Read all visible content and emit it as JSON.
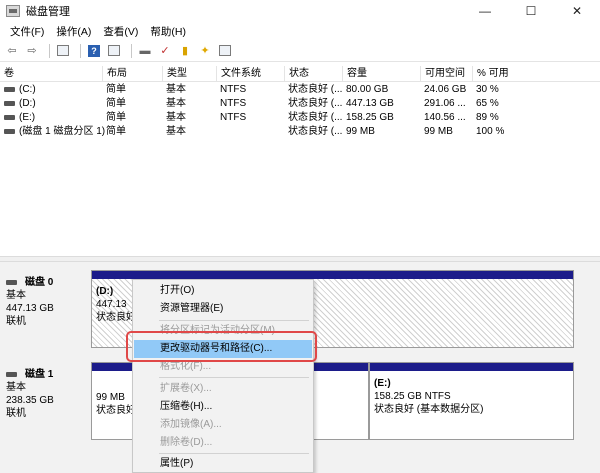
{
  "window": {
    "title": "磁盘管理",
    "controls": {
      "minimize": "—",
      "maximize": "☐",
      "close": "✕"
    }
  },
  "menubar": [
    "文件(F)",
    "操作(A)",
    "查看(V)",
    "帮助(H)"
  ],
  "toolbar": [
    "back-icon",
    "forward-icon",
    "list-icon",
    "help-icon",
    "console-icon",
    "disk-icon",
    "check-icon",
    "new-icon",
    "star-icon",
    "properties-icon"
  ],
  "volume_list": {
    "columns": [
      "卷",
      "布局",
      "类型",
      "文件系统",
      "状态",
      "容量",
      "可用空间",
      "% 可用"
    ],
    "rows": [
      [
        "(C:)",
        "简单",
        "基本",
        "NTFS",
        "状态良好 (...",
        "80.00 GB",
        "24.06 GB",
        "30 %"
      ],
      [
        "(D:)",
        "简单",
        "基本",
        "NTFS",
        "状态良好 (...",
        "447.13 GB",
        "291.06 ...",
        "65 %"
      ],
      [
        "(E:)",
        "简单",
        "基本",
        "NTFS",
        "状态良好 (...",
        "158.25 GB",
        "140.56 ...",
        "89 %"
      ],
      [
        "(磁盘 1 磁盘分区 1)",
        "简单",
        "基本",
        "",
        "状态良好 (...",
        "99 MB",
        "99 MB",
        "100 %"
      ]
    ]
  },
  "disks": [
    {
      "name": "磁盘 0",
      "type": "基本",
      "size": "447.13 GB",
      "status": "联机",
      "partition": {
        "label": "(D:)",
        "size": "447.13",
        "status": "状态良好"
      }
    },
    {
      "name": "磁盘 1",
      "type": "基本",
      "size": "238.35 GB",
      "status": "联机",
      "partition_small": {
        "size": "99 MB",
        "status": "状态良好"
      },
      "partition_e": {
        "label": "(E:)",
        "size": "158.25 GB NTFS",
        "status": "状态良好 (基本数据分区)"
      }
    }
  ],
  "context_menu": {
    "items": [
      {
        "label": "打开(O)",
        "enabled": true
      },
      {
        "label": "资源管理器(E)",
        "enabled": true
      },
      {
        "label": "将分区标记为活动分区(M)",
        "enabled": false
      },
      {
        "label": "更改驱动器号和路径(C)...",
        "enabled": true,
        "selected": true
      },
      {
        "label": "格式化(F)...",
        "enabled": false
      },
      {
        "label": "扩展卷(X)...",
        "enabled": false
      },
      {
        "label": "压缩卷(H)...",
        "enabled": true
      },
      {
        "label": "添加镜像(A)...",
        "enabled": false
      },
      {
        "label": "删除卷(D)...",
        "enabled": false
      },
      {
        "label": "属性(P)",
        "enabled": true
      }
    ]
  },
  "colors": {
    "partition_cap": "#1c1c8a",
    "selected_item": "#91c9f7",
    "highlight_outline": "#e04848"
  }
}
